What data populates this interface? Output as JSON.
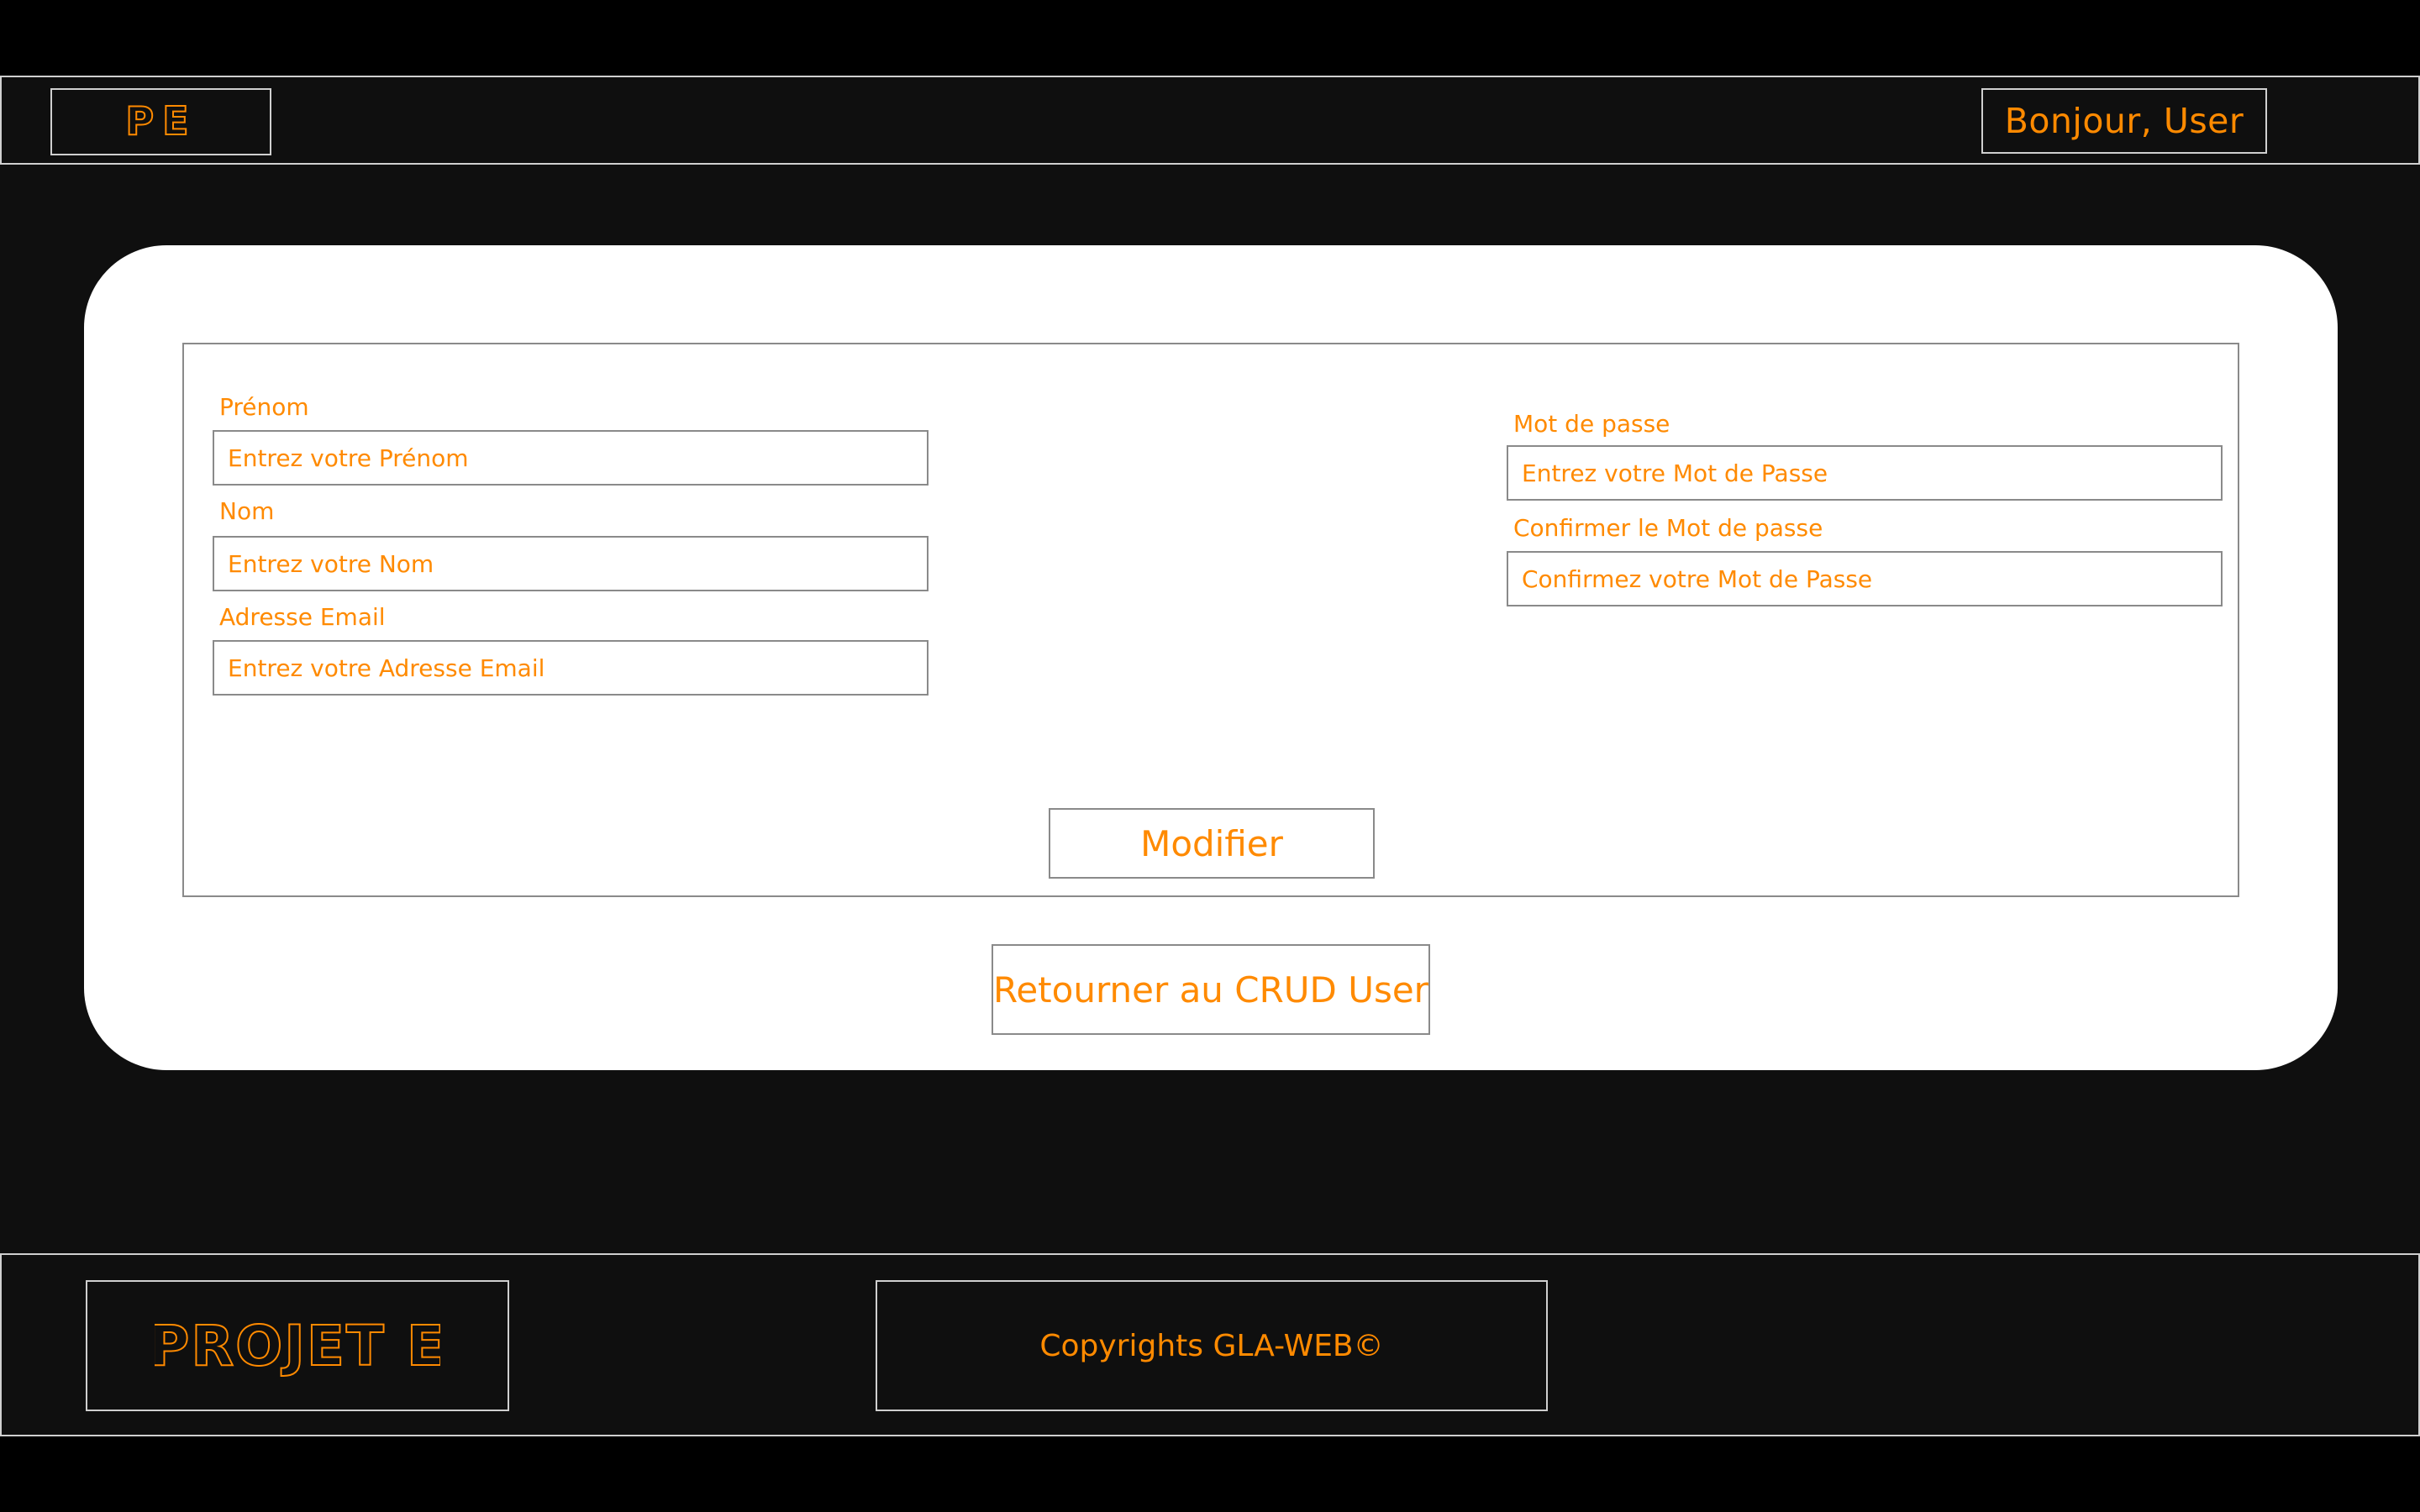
{
  "header": {
    "logo_text": "PE",
    "greeting": "Bonjour, User"
  },
  "form": {
    "fields": [
      {
        "label": "Prénom",
        "placeholder": "Entrez votre Prénom",
        "value": ""
      },
      {
        "label": "Nom",
        "placeholder": "Entrez votre Nom",
        "value": ""
      },
      {
        "label": "Adresse Email",
        "placeholder": "Entrez votre Adresse Email",
        "value": ""
      },
      {
        "label": "Mot de passe",
        "placeholder": "Entrez votre Mot de Passe",
        "value": ""
      },
      {
        "label": "Confirmer le Mot de passe",
        "placeholder": "Confirmez votre Mot de Passe",
        "value": ""
      }
    ],
    "submit_label": "Modifier"
  },
  "return_label": "Retourner au CRUD User",
  "footer": {
    "logo_text": "PROJET E",
    "copyright": "Copyrights GLA-WEB©"
  },
  "colors": {
    "accent": "#ff8a00",
    "background": "#0f0f0f",
    "card": "#ffffff",
    "border": "#cfcfcf"
  }
}
